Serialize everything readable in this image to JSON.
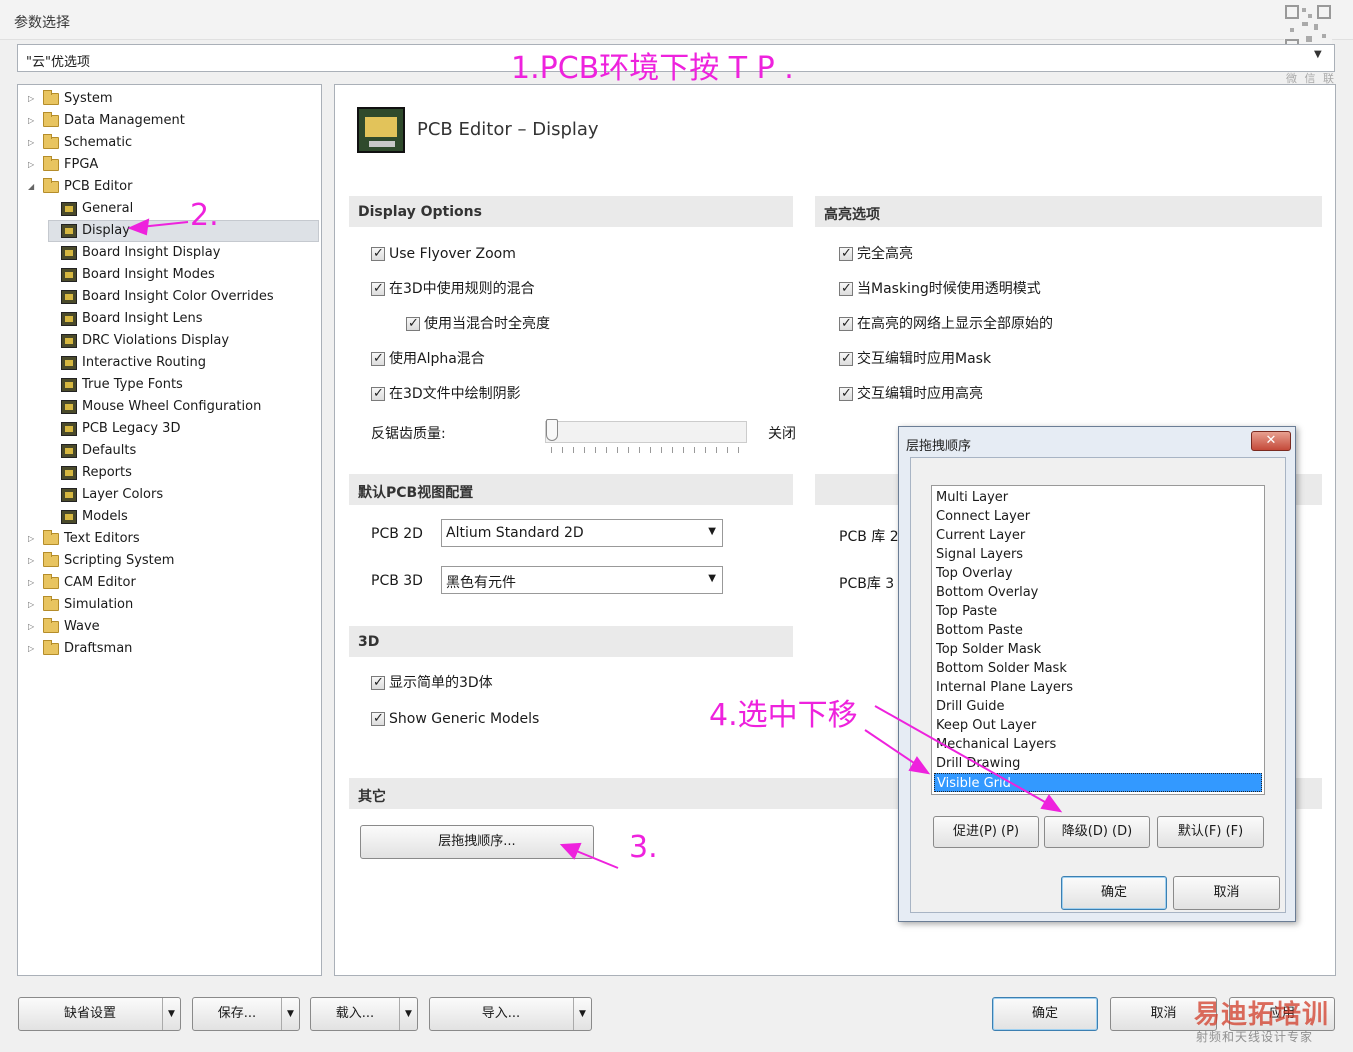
{
  "window": {
    "title": "参数选择",
    "close_glyph": "✕"
  },
  "search": {
    "value": "\"云\"优选项"
  },
  "qr_caption": "微 信 联 系",
  "tree": {
    "top_items": [
      {
        "label": "System",
        "expanded": false
      },
      {
        "label": "Data Management",
        "expanded": false
      },
      {
        "label": "Schematic",
        "expanded": false
      },
      {
        "label": "FPGA",
        "expanded": false
      },
      {
        "label": "PCB Editor",
        "expanded": true
      }
    ],
    "pcb_children": [
      "General",
      "Display",
      "Board Insight Display",
      "Board Insight Modes",
      "Board Insight Color Overrides",
      "Board Insight Lens",
      "DRC Violations Display",
      "Interactive Routing",
      "True Type Fonts",
      "Mouse Wheel Configuration",
      "PCB Legacy 3D",
      "Defaults",
      "Reports",
      "Layer Colors",
      "Models"
    ],
    "selected": "Display",
    "bottom_items": [
      "Text Editors",
      "Scripting System",
      "CAM Editor",
      "Simulation",
      "Wave",
      "Draftsman"
    ]
  },
  "panel": {
    "title": "PCB Editor – Display",
    "display_options": {
      "header": "Display Options",
      "items": [
        {
          "label": "Use Flyover Zoom",
          "checked": true
        },
        {
          "label": "在3D中使用规则的混合",
          "checked": true
        },
        {
          "label": "使用当混合时全亮度",
          "checked": true
        },
        {
          "label": "使用Alpha混合",
          "checked": true
        },
        {
          "label": "在3D文件中绘制阴影",
          "checked": true
        }
      ],
      "aa_label": "反锯齿质量:",
      "aa_value": "关闭"
    },
    "highlight": {
      "header": "高亮选项",
      "items": [
        {
          "label": "完全高亮",
          "checked": true
        },
        {
          "label": "当Masking时候使用透明模式",
          "checked": true
        },
        {
          "label": "在高亮的网络上显示全部原始的",
          "checked": true
        },
        {
          "label": "交互编辑时应用Mask",
          "checked": true
        },
        {
          "label": "交互编辑时应用高亮",
          "checked": true
        }
      ]
    },
    "default_view": {
      "header": "默认PCB视图配置",
      "pcb2d_label": "PCB 2D",
      "pcb2d_value": "Altium Standard 2D",
      "pcb3d_label": "PCB 3D",
      "pcb3d_value": "黑色有元件",
      "lib2d_label": "PCB 库 2",
      "lib3d_label": "PCB库 3"
    },
    "three_d": {
      "header": "3D",
      "items": [
        {
          "label": "显示简单的3D体",
          "checked": true
        },
        {
          "label": "Show Generic Models",
          "checked": true
        }
      ]
    },
    "other": {
      "header": "其它",
      "layer_order_button": "层拖拽顺序..."
    }
  },
  "dialog": {
    "title": "层拖拽顺序",
    "close_glyph": "✕",
    "layers": [
      "Multi Layer",
      "Connect Layer",
      "Current Layer",
      "Signal Layers",
      "Top Overlay",
      "Bottom Overlay",
      "Top Paste",
      "Bottom Paste",
      "Top Solder Mask",
      "Bottom Solder Mask",
      "Internal Plane Layers",
      "Drill Guide",
      "Keep Out Layer",
      "Mechanical Layers",
      "Drill Drawing",
      "Visible Grid"
    ],
    "selected_layer": "Visible Grid",
    "promote": "促进(P) (P)",
    "demote": "降级(D) (D)",
    "default": "默认(F) (F)",
    "ok": "确定",
    "cancel": "取消"
  },
  "footer": {
    "defaults": "缺省设置",
    "save": "保存...",
    "load": "载入...",
    "import": "导入...",
    "ok": "确定",
    "cancel": "取消",
    "apply": "应用"
  },
  "annotations": {
    "step1": "1.PCB环境下按 T P .",
    "step2": "2.",
    "step3": "3.",
    "step4": "4.选中下移",
    "color": "#ee22dd"
  },
  "watermark": {
    "line1": "易迪拓培训",
    "line2": "射频和天线设计专家"
  }
}
